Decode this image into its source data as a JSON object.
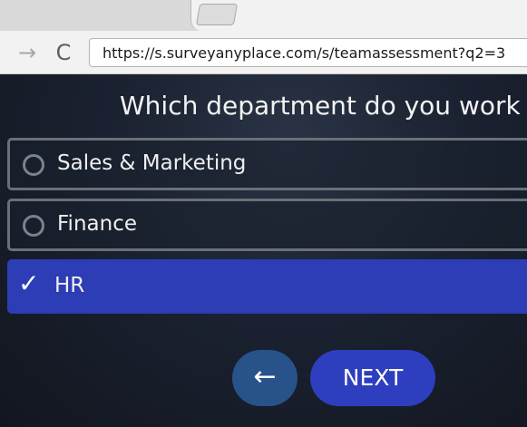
{
  "browser": {
    "url": "https://s.surveyanyplace.com/s/teamassessment?q2=3",
    "forward_icon": "→",
    "reload_icon": "C"
  },
  "survey": {
    "question": "Which department do you work in?",
    "options": [
      {
        "label": "Sales & Marketing",
        "selected": false
      },
      {
        "label": "Finance",
        "selected": false
      },
      {
        "label": "HR",
        "selected": true
      }
    ],
    "selected_check": "✓",
    "back_icon": "←",
    "next_label": "NEXT",
    "colors": {
      "selected": "#2c3db5",
      "next_button": "#2d3fbe",
      "back_button": "#27528a"
    }
  }
}
